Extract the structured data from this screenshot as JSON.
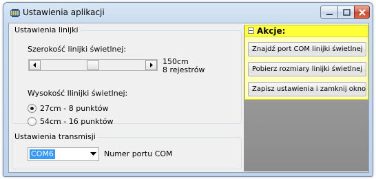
{
  "window": {
    "title": "Ustawienia aplikacji"
  },
  "ruler_settings": {
    "legend": "Ustawienia linijki",
    "width_label": "Szerokość linijki świetlnej:",
    "width_value": "150cm",
    "registers_value": "8 rejestrów",
    "slider_fraction": 0.5,
    "height_label": "Wysokość llinijki świetlnej:",
    "options": [
      {
        "label": "27cm - 8 punktów",
        "selected": true
      },
      {
        "label": "54cm - 16 punktów",
        "selected": false
      }
    ]
  },
  "transmission_settings": {
    "legend": "Ustawienia transmisji",
    "port_value": "COM6",
    "port_label": "Numer portu COM"
  },
  "actions": {
    "title": "Akcje:",
    "buttons": [
      "Znajdź port COM linijki świetlnej",
      "Pobierz rozmiary linijki świetlnej",
      "Zapisz ustawienia i zamknij okno"
    ]
  },
  "colors": {
    "actions_header": "#ffff3a",
    "actions_body": "#ffffbf",
    "selection": "#3399ff"
  }
}
